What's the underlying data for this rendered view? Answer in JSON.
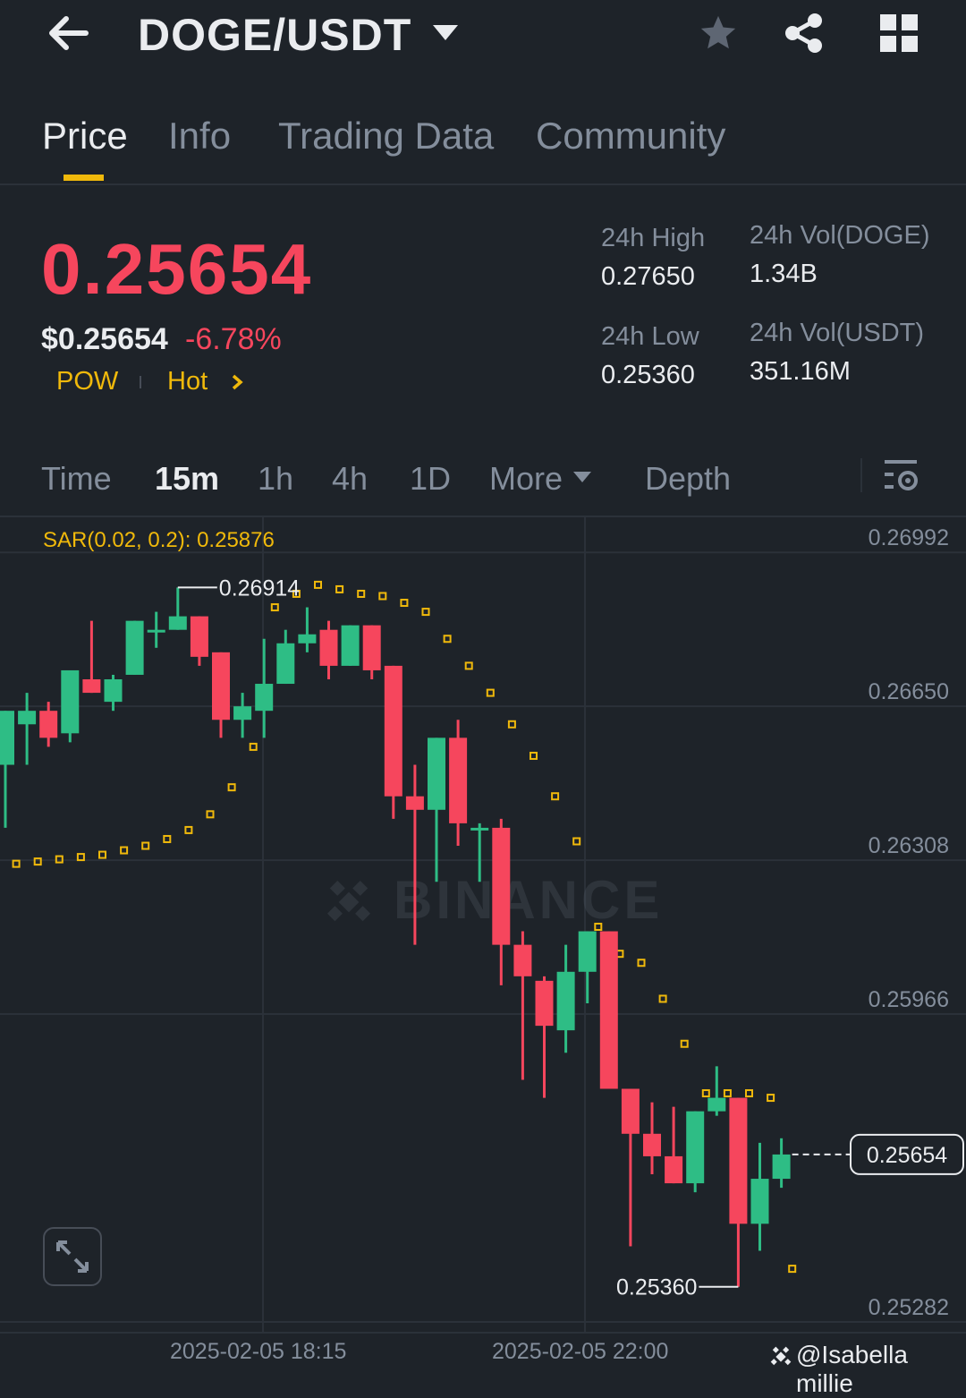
{
  "header": {
    "title": "DOGE/USDT",
    "icons": [
      "back-arrow-icon",
      "caret-down-icon",
      "star-icon",
      "share-icon",
      "grid-icon"
    ]
  },
  "tabs": [
    {
      "label": "Price",
      "active": true
    },
    {
      "label": "Info",
      "active": false
    },
    {
      "label": "Trading Data",
      "active": false
    },
    {
      "label": "Community",
      "active": false
    }
  ],
  "ticker": {
    "price": "0.25654",
    "usd_price": "$0.25654",
    "change": "-6.78%",
    "tags": [
      "POW",
      "Hot"
    ],
    "high_label": "24h High",
    "high": "0.27650",
    "low_label": "24h Low",
    "low": "0.25360",
    "vol_doge_label": "24h Vol(DOGE)",
    "vol_doge": "1.34B",
    "vol_usdt_label": "24h Vol(USDT)",
    "vol_usdt": "351.16M"
  },
  "timeframes": {
    "items": [
      "Time",
      "15m",
      "1h",
      "4h",
      "1D"
    ],
    "active": "15m",
    "more": "More",
    "depth": "Depth"
  },
  "colors": {
    "up": "#2ebd85",
    "down": "#f6465d",
    "accent": "#f0b90b",
    "background": "#1e2329"
  },
  "chart_data": {
    "type": "candlestick",
    "indicator_label": "SAR(0.02, 0.2): 0.25876",
    "y_ticks": [
      "0.26992",
      "0.26650",
      "0.26308",
      "0.25966",
      "0.25282"
    ],
    "x_ticks": [
      "2025-02-05 18:15",
      "2025-02-05 22:00"
    ],
    "ylim": [
      0.2526,
      0.2707
    ],
    "current_price_label": "0.25654",
    "max_label": "0.26914",
    "min_label": "0.25360",
    "watermark": "BINANCE",
    "candles": [
      {
        "o": 0.2652,
        "h": 0.2658,
        "l": 0.2638,
        "c": 0.2664
      },
      {
        "o": 0.2661,
        "h": 0.2668,
        "l": 0.2652,
        "c": 0.2664
      },
      {
        "o": 0.2664,
        "h": 0.2666,
        "l": 0.2656,
        "c": 0.2658
      },
      {
        "o": 0.2659,
        "h": 0.2673,
        "l": 0.2657,
        "c": 0.2673
      },
      {
        "o": 0.2671,
        "h": 0.2684,
        "l": 0.2668,
        "c": 0.2668
      },
      {
        "o": 0.2666,
        "h": 0.2672,
        "l": 0.2664,
        "c": 0.2671
      },
      {
        "o": 0.2672,
        "h": 0.2683,
        "l": 0.2672,
        "c": 0.2684
      },
      {
        "o": 0.2682,
        "h": 0.2686,
        "l": 0.2678,
        "c": 0.2682
      },
      {
        "o": 0.2682,
        "h": 0.26914,
        "l": 0.2682,
        "c": 0.2685
      },
      {
        "o": 0.2685,
        "h": 0.2685,
        "l": 0.2674,
        "c": 0.2676
      },
      {
        "o": 0.2677,
        "h": 0.2677,
        "l": 0.2658,
        "c": 0.2662
      },
      {
        "o": 0.2662,
        "h": 0.2668,
        "l": 0.2658,
        "c": 0.2665
      },
      {
        "o": 0.2664,
        "h": 0.268,
        "l": 0.2658,
        "c": 0.267
      },
      {
        "o": 0.267,
        "h": 0.2682,
        "l": 0.267,
        "c": 0.2679
      },
      {
        "o": 0.2679,
        "h": 0.2687,
        "l": 0.2677,
        "c": 0.2681
      },
      {
        "o": 0.2682,
        "h": 0.2684,
        "l": 0.2671,
        "c": 0.2674
      },
      {
        "o": 0.2674,
        "h": 0.2682,
        "l": 0.2674,
        "c": 0.2683
      },
      {
        "o": 0.2683,
        "h": 0.2683,
        "l": 0.2671,
        "c": 0.2673
      },
      {
        "o": 0.2674,
        "h": 0.2674,
        "l": 0.264,
        "c": 0.2645
      },
      {
        "o": 0.2645,
        "h": 0.2652,
        "l": 0.2612,
        "c": 0.2642
      },
      {
        "o": 0.2642,
        "h": 0.2658,
        "l": 0.2626,
        "c": 0.2658
      },
      {
        "o": 0.2658,
        "h": 0.2662,
        "l": 0.2634,
        "c": 0.2639
      },
      {
        "o": 0.2638,
        "h": 0.2639,
        "l": 0.2626,
        "c": 0.2638
      },
      {
        "o": 0.2638,
        "h": 0.264,
        "l": 0.2603,
        "c": 0.2612
      },
      {
        "o": 0.2612,
        "h": 0.2615,
        "l": 0.2582,
        "c": 0.2605
      },
      {
        "o": 0.2604,
        "h": 0.2605,
        "l": 0.2578,
        "c": 0.2594
      },
      {
        "o": 0.2593,
        "h": 0.2612,
        "l": 0.2588,
        "c": 0.2606
      },
      {
        "o": 0.2606,
        "h": 0.2613,
        "l": 0.2599,
        "c": 0.2615
      },
      {
        "o": 0.2615,
        "h": 0.2615,
        "l": 0.259,
        "c": 0.258
      },
      {
        "o": 0.258,
        "h": 0.2579,
        "l": 0.2545,
        "c": 0.257
      },
      {
        "o": 0.257,
        "h": 0.2577,
        "l": 0.2561,
        "c": 0.2565
      },
      {
        "o": 0.2565,
        "h": 0.2576,
        "l": 0.256,
        "c": 0.2559
      },
      {
        "o": 0.2559,
        "h": 0.2575,
        "l": 0.2557,
        "c": 0.2575
      },
      {
        "o": 0.2575,
        "h": 0.2585,
        "l": 0.2574,
        "c": 0.2578
      },
      {
        "o": 0.2578,
        "h": 0.2576,
        "l": 0.2536,
        "c": 0.255
      },
      {
        "o": 0.255,
        "h": 0.2568,
        "l": 0.2544,
        "c": 0.256
      },
      {
        "o": 0.256,
        "h": 0.2569,
        "l": 0.2558,
        "c": 0.25654
      }
    ],
    "sar": [
      0.263,
      0.26305,
      0.2631,
      0.26315,
      0.2632,
      0.2633,
      0.2634,
      0.26355,
      0.26375,
      0.2641,
      0.2647,
      0.2656,
      0.2687,
      0.269,
      0.2692,
      0.2691,
      0.269,
      0.26895,
      0.2688,
      0.2686,
      0.268,
      0.2674,
      0.2668,
      0.2661,
      0.2654,
      0.2645,
      0.2635,
      0.2616,
      0.261,
      0.2608,
      0.26,
      0.259,
      0.2579,
      0.2579,
      0.2579,
      0.2578,
      0.254
    ],
    "sar_points": [
      [
        1,
        0.263
      ],
      [
        2,
        0.26305
      ],
      [
        3,
        0.2631
      ],
      [
        4,
        0.26315
      ],
      [
        5,
        0.2632
      ],
      [
        6,
        0.2633
      ],
      [
        7,
        0.2634
      ],
      [
        8,
        0.26355
      ],
      [
        9,
        0.26375
      ],
      [
        10,
        0.2641
      ],
      [
        11,
        0.2647
      ],
      [
        12,
        0.2656
      ],
      [
        13,
        0.2687
      ],
      [
        14,
        0.269
      ],
      [
        15,
        0.2692
      ],
      [
        16,
        0.2691
      ],
      [
        17,
        0.269
      ],
      [
        18,
        0.26895
      ],
      [
        19,
        0.2688
      ],
      [
        20,
        0.2686
      ],
      [
        21,
        0.268
      ],
      [
        22,
        0.2674
      ],
      [
        23,
        0.2668
      ],
      [
        24,
        0.2661
      ],
      [
        25,
        0.2654
      ],
      [
        26,
        0.2645
      ],
      [
        27,
        0.2635
      ],
      [
        28,
        0.2616
      ],
      [
        29,
        0.261
      ],
      [
        30,
        0.2608
      ],
      [
        31,
        0.26
      ],
      [
        32,
        0.259
      ],
      [
        33,
        0.2579
      ],
      [
        34,
        0.2579
      ],
      [
        35,
        0.2579
      ],
      [
        36,
        0.2578
      ],
      [
        37,
        0.254
      ]
    ]
  },
  "footer": {
    "credit": "@Isabella millie"
  }
}
